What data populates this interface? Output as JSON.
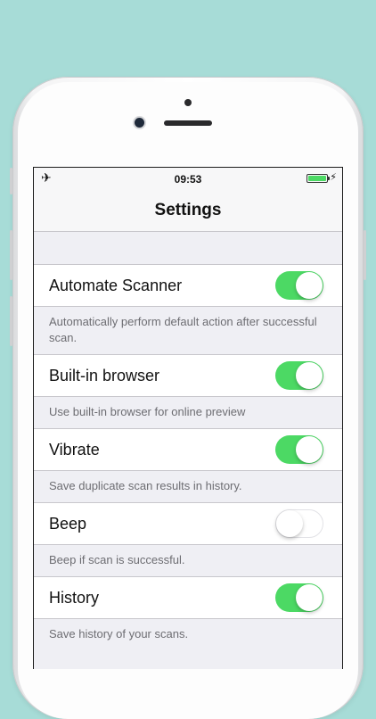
{
  "status_bar": {
    "time": "09:53",
    "airplane_icon": "airplane-icon",
    "battery_icon": "battery-charging-icon"
  },
  "nav": {
    "title": "Settings"
  },
  "settings": [
    {
      "label": "Automate Scanner",
      "on": true,
      "footer": "Automatically perform default action after successful scan."
    },
    {
      "label": "Built-in browser",
      "on": true,
      "footer": "Use built-in browser for online preview"
    },
    {
      "label": "Vibrate",
      "on": true,
      "footer": "Save duplicate scan results in history."
    },
    {
      "label": "Beep",
      "on": false,
      "footer": "Beep if scan is successful."
    },
    {
      "label": "History",
      "on": true,
      "footer": "Save history of your scans."
    }
  ],
  "colors": {
    "background": "#a7dcd7",
    "toggle_on": "#4cd964",
    "group_bg": "#efeff4"
  }
}
